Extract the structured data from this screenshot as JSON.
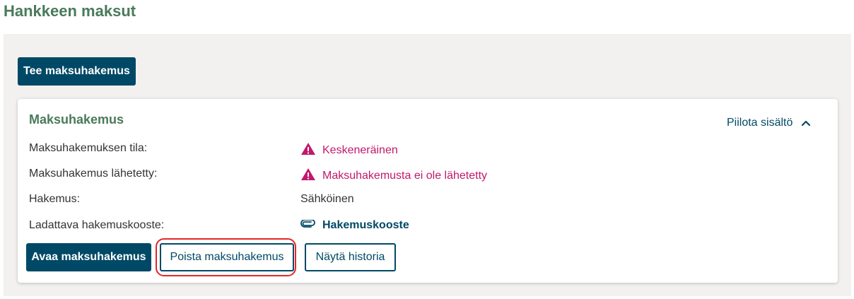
{
  "page_title": "Hankkeen maksut",
  "actions": {
    "create_label": "Tee maksuhakemus"
  },
  "card": {
    "title": "Maksuhakemus",
    "toggle_label": "Piilota sisältö",
    "toggle_icon": "chevron-up-icon",
    "rows": [
      {
        "label": "Maksuhakemuksen tila:",
        "value": "Keskeneräinen",
        "icon": "warning-icon"
      },
      {
        "label": "Maksuhakemus lähetetty:",
        "value": "Maksuhakemusta ei ole lähetetty",
        "icon": "warning-icon"
      },
      {
        "label": "Hakemus:",
        "value": "Sähköinen"
      },
      {
        "label": "Ladattava hakemuskooste:",
        "value": "Hakemuskooste",
        "icon": "paperclip-icon"
      }
    ],
    "buttons": {
      "open_label": "Avaa maksuhakemus",
      "delete_label": "Poista maksuhakemus",
      "history_label": "Näytä historia"
    }
  },
  "colors": {
    "heading": "#4a7a5a",
    "primary": "#004966",
    "warning": "#c2186d",
    "highlight": "#e3262b",
    "panel_bg": "#f2f1ef"
  }
}
